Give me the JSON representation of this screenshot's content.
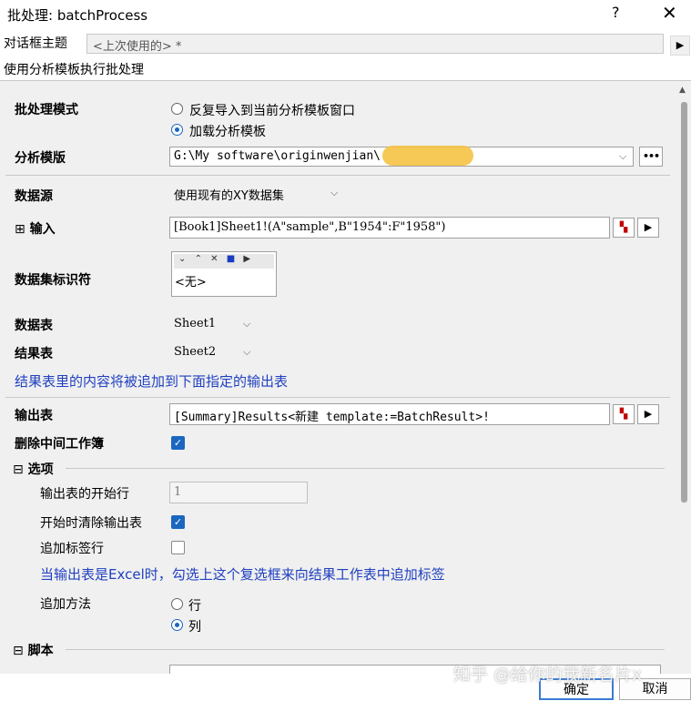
{
  "window": {
    "title": "批处理: batchProcess",
    "help": "?",
    "close": "✕"
  },
  "theme": {
    "label": "对话框主题",
    "value": "<上次使用的> *",
    "arrow": "▶"
  },
  "description": "使用分析模板执行批处理",
  "mode": {
    "label": "批处理模式",
    "options": [
      {
        "label": "反复导入到当前分析模板窗口",
        "selected": false
      },
      {
        "label": "加载分析模板",
        "selected": true
      }
    ]
  },
  "template": {
    "label": "分析模版",
    "value": "G:\\My software\\originwenjian\\",
    "dots": "•••"
  },
  "datasource": {
    "label": "数据源",
    "value": "使用现有的XY数据集"
  },
  "input": {
    "expand": "⊞",
    "label": "输入",
    "value": "[Book1]Sheet1!(A\"sample\",B\"1954\":F\"1958\")"
  },
  "identifier": {
    "label": "数据集标识符",
    "value": "<无>"
  },
  "datasheet": {
    "label": "数据表",
    "value": "Sheet1"
  },
  "resultsheet": {
    "label": "结果表",
    "value": "Sheet2"
  },
  "note_append": "结果表里的内容将被追加到下面指定的输出表",
  "output": {
    "label": "输出表",
    "value": "[Summary]Results<新建 template:=BatchResult>!"
  },
  "delete_books": {
    "label": "删除中间工作簿",
    "checked": true
  },
  "options": {
    "expand": "⊟",
    "label": "选项",
    "start_row": {
      "label": "输出表的开始行",
      "value": "1"
    },
    "clear_output": {
      "label": "开始时清除输出表",
      "checked": true
    },
    "append_label": {
      "label": "追加标签行",
      "checked": false
    },
    "excel_note": "当输出表是Excel时，勾选上这个复选框来向结果工作表中追加标签",
    "append_method": {
      "label": "追加方法",
      "options": [
        {
          "label": "行",
          "selected": false
        },
        {
          "label": "列",
          "selected": true
        }
      ]
    }
  },
  "script": {
    "expand": "⊟",
    "label": "脚本"
  },
  "footer": {
    "ok": "确定",
    "cancel": "取消"
  },
  "watermark": "知乎 @给你的我新名片x"
}
